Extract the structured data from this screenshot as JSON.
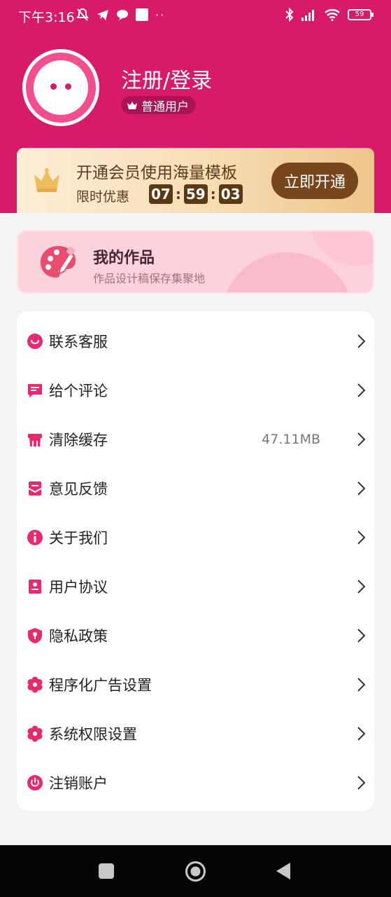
{
  "status_bar": {
    "time": "下午3:16",
    "battery": "59"
  },
  "profile": {
    "login_label": "注册/登录",
    "user_type": "普通用户"
  },
  "vip_banner": {
    "title": "开通会员使用海量模板",
    "limited": "限时优惠",
    "countdown": {
      "hours": "07",
      "minutes": "59",
      "seconds": "03"
    },
    "button_label": "立即开通"
  },
  "works": {
    "title": "我的作品",
    "subtitle": "作品设计稿保存集聚地"
  },
  "menu": {
    "items": [
      {
        "label": "联系客服",
        "value": "",
        "icon": "chat-icon"
      },
      {
        "label": "给个评论",
        "value": "",
        "icon": "comment-icon"
      },
      {
        "label": "清除缓存",
        "value": "47.11MB",
        "icon": "broom-icon"
      },
      {
        "label": "意见反馈",
        "value": "",
        "icon": "feedback-icon"
      },
      {
        "label": "关于我们",
        "value": "",
        "icon": "info-icon"
      },
      {
        "label": "用户协议",
        "value": "",
        "icon": "agreement-icon"
      },
      {
        "label": "隐私政策",
        "value": "",
        "icon": "shield-icon"
      },
      {
        "label": "程序化广告设置",
        "value": "",
        "icon": "gear-icon"
      },
      {
        "label": "系统权限设置",
        "value": "",
        "icon": "gear-icon"
      },
      {
        "label": "注销账户",
        "value": "",
        "icon": "power-icon"
      }
    ]
  },
  "colors": {
    "brand": "#d81b68",
    "accent_icon": "#e8286f",
    "vip_button": "#78461c"
  }
}
